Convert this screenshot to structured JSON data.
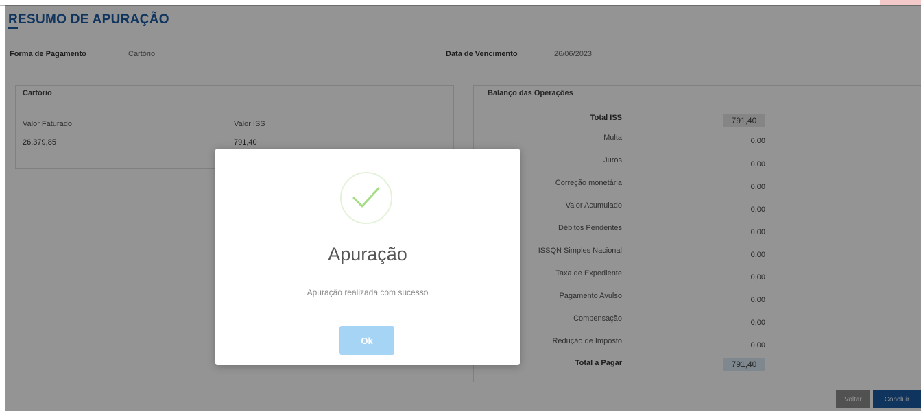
{
  "header": {
    "title": "RESUMO DE APURAÇÃO"
  },
  "payment": {
    "method_label": "Forma de Pagamento",
    "method_value": "Cartório",
    "due_label": "Data de Vencimento",
    "due_value": "26/06/2023"
  },
  "cartorio_panel": {
    "legend": "Cartório",
    "faturado_label": "Valor Faturado",
    "faturado_value": "26.379,85",
    "iss_label": "Valor ISS",
    "iss_value": "791,40"
  },
  "balance": {
    "legend": "Balanço das Operações",
    "rows": [
      {
        "label": "Total ISS",
        "value": "791,40"
      },
      {
        "label": "Multa",
        "value": "0,00"
      },
      {
        "label": "Juros",
        "value": "0,00"
      },
      {
        "label": "Correção monetária",
        "value": "0,00"
      },
      {
        "label": "Valor Acumulado",
        "value": "0,00"
      },
      {
        "label": "Débitos Pendentes",
        "value": "0,00"
      },
      {
        "label": "ISSQN Simples Nacional",
        "value": "0,00"
      },
      {
        "label": "Taxa de Expediente",
        "value": "0,00"
      },
      {
        "label": "Pagamento Avulso",
        "value": "0,00"
      },
      {
        "label": "Compensação",
        "value": "0,00"
      },
      {
        "label": "Redução de Imposto",
        "value": "0,00"
      },
      {
        "label": "Total a Pagar",
        "value": "791,40"
      }
    ]
  },
  "actions": {
    "back": "Voltar",
    "finish": "Concluir"
  },
  "modal": {
    "icon": "checkmark-icon",
    "title": "Apuração",
    "message": "Apuração realizada com sucesso",
    "ok": "Ok"
  },
  "colors": {
    "brand_blue": "#1b5aa3",
    "success_green": "#a5dc86",
    "ok_button": "#a6d4f5"
  }
}
